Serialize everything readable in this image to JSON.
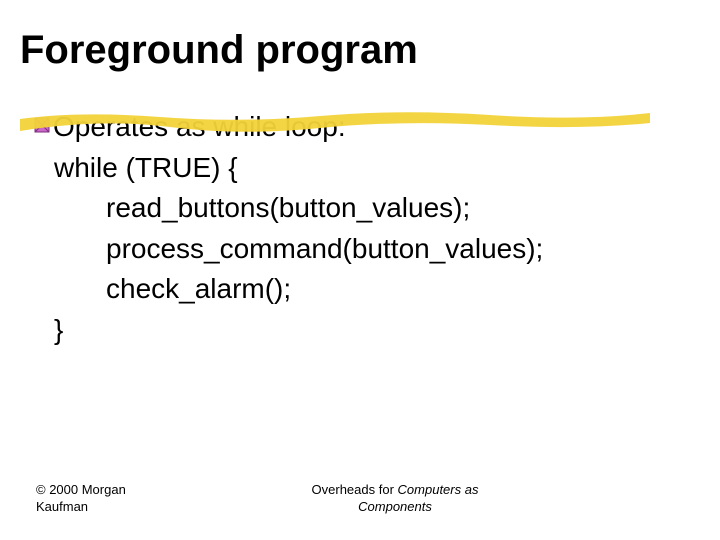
{
  "title": "Foreground program",
  "bullet": "Operates as while loop:",
  "code": {
    "l1": "while (TRUE) {",
    "l2": "read_buttons(button_values);",
    "l3": "process_command(button_values);",
    "l4": "check_alarm();",
    "l5": "}"
  },
  "footer": {
    "copyright_l1": "© 2000 Morgan",
    "copyright_l2": "Kaufman",
    "center_prefix": "Overheads for ",
    "center_em": "Computers as",
    "center_l2_em": "Components"
  }
}
